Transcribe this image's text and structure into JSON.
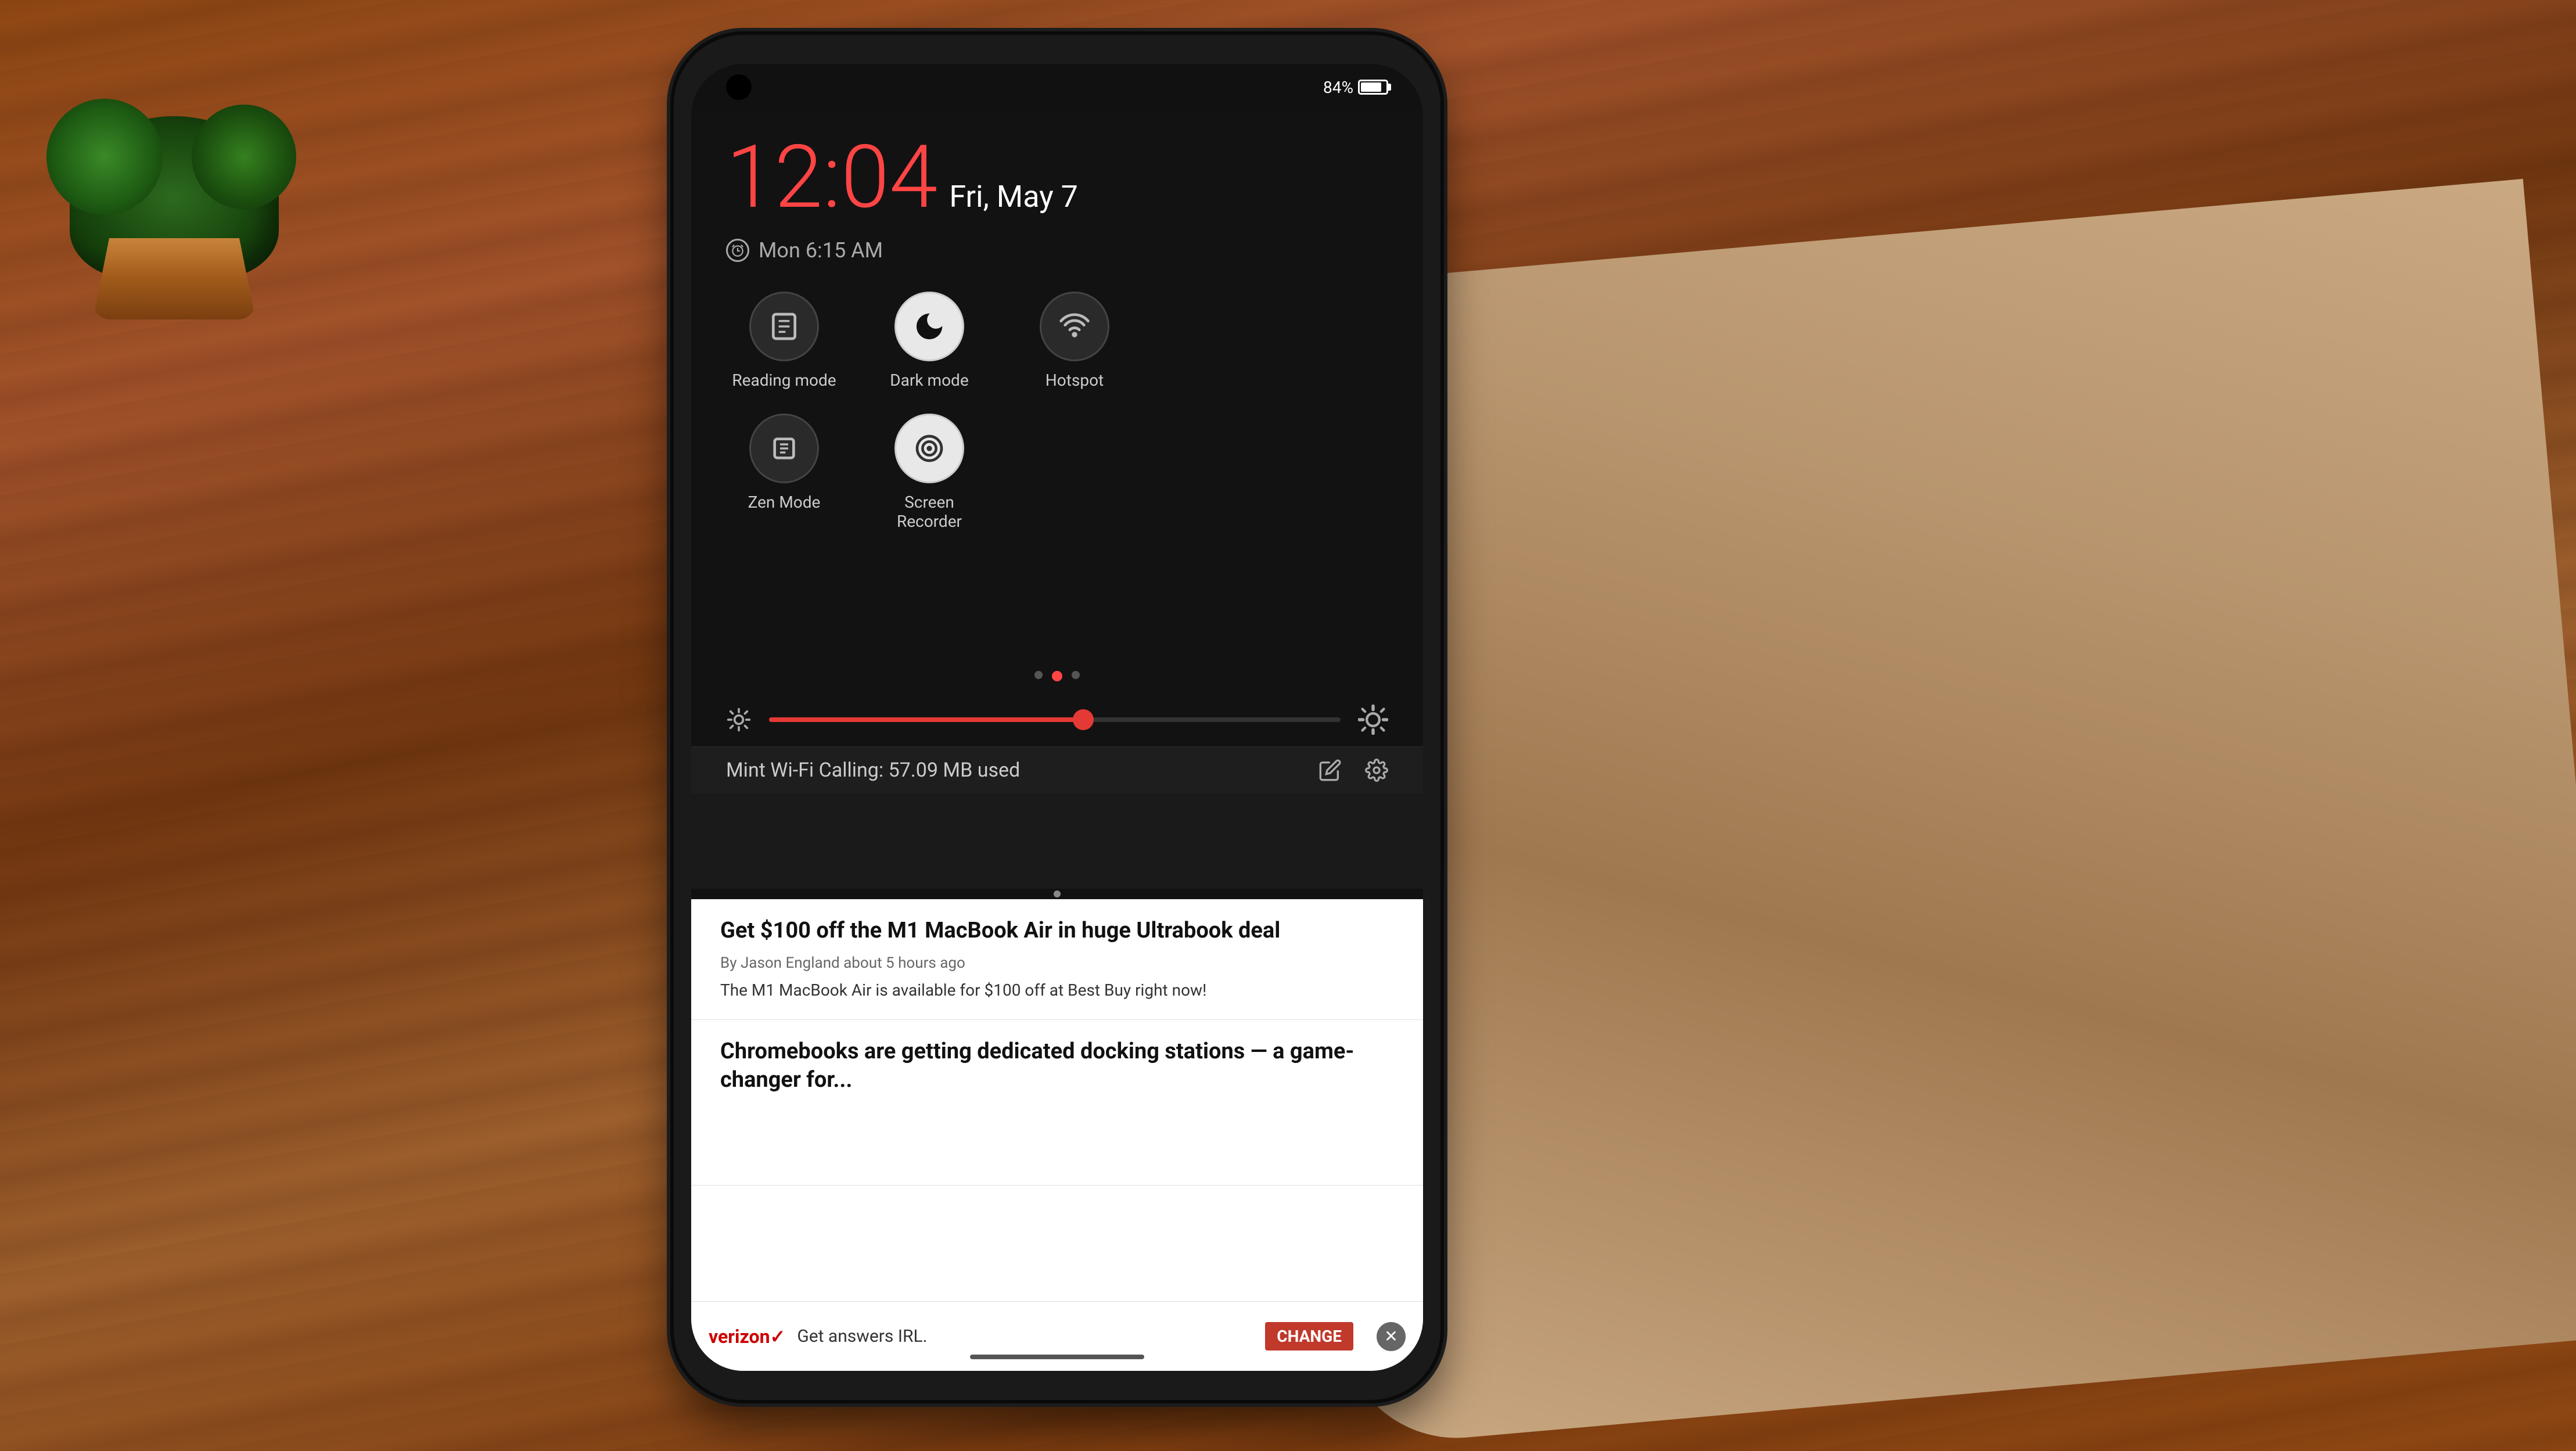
{
  "background": {
    "color": "#6B3A0F"
  },
  "phone": {
    "status_bar": {
      "battery_percent": "84%",
      "battery_value": 84
    },
    "clock": {
      "time": "12:04",
      "date": "Fri, May 7"
    },
    "alarm": {
      "label": "Mon 6:15 AM",
      "icon": "alarm-icon"
    },
    "quick_tiles": [
      {
        "id": "reading-mode",
        "label": "Reading mode",
        "active": false,
        "icon": "book-icon"
      },
      {
        "id": "dark-mode",
        "label": "Dark mode",
        "active": true,
        "icon": "moon-icon"
      },
      {
        "id": "hotspot",
        "label": "Hotspot",
        "active": false,
        "icon": "hotspot-icon"
      },
      {
        "id": "zen-mode",
        "label": "Zen Mode",
        "active": false,
        "icon": "zen-icon"
      },
      {
        "id": "screen-recorder",
        "label": "Screen Recorder",
        "active": false,
        "icon": "record-icon"
      }
    ],
    "brightness": {
      "value": 55,
      "aria_label": "Brightness slider"
    },
    "network": {
      "name": "Mint Wi-Fi Calling: 57.09 MB used",
      "edit_label": "Edit",
      "settings_label": "Settings"
    },
    "articles": [
      {
        "title": "Get $100 off the M1 MacBook Air in huge Ultrabook deal",
        "byline": "By Jason England  about 5 hours ago",
        "excerpt": "The M1 MacBook Air is available for $100 off at Best Buy right now!"
      },
      {
        "title": "Chromebooks are getting dedicated docking stations — a game-changer for...",
        "byline": "",
        "excerpt": ""
      }
    ],
    "ad": {
      "brand": "verizon✓",
      "text": "Get answers IRL.",
      "label": "CHANGE"
    },
    "home_indicator": true
  }
}
